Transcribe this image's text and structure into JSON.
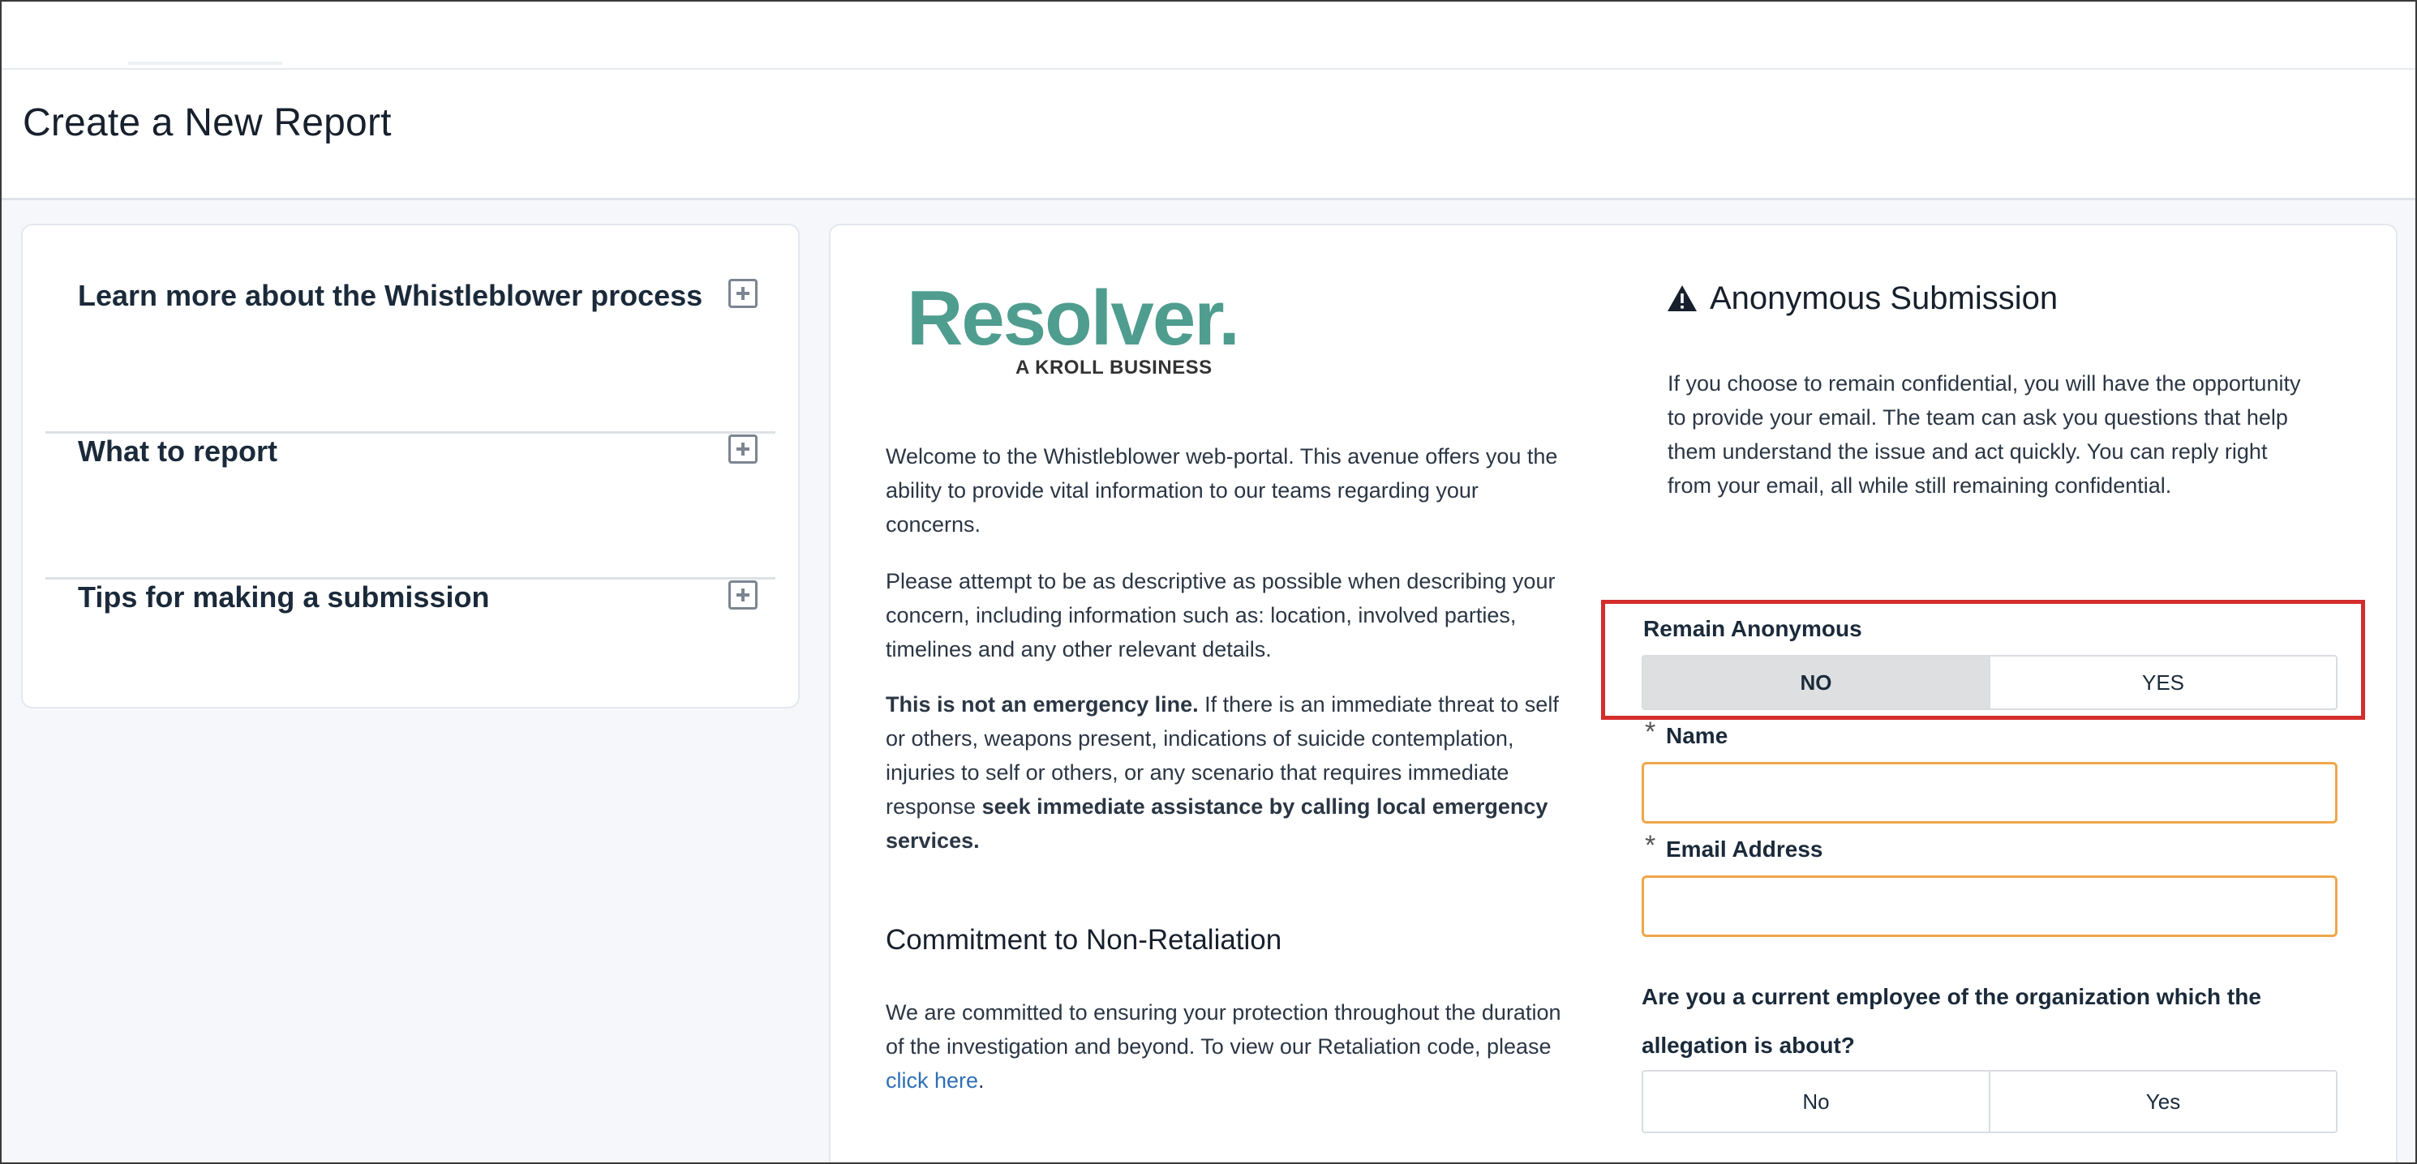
{
  "page": {
    "title": "Create a New Report"
  },
  "sidebar": {
    "items": [
      {
        "label": "Learn more about the Whistleblower process"
      },
      {
        "label": "What to report"
      },
      {
        "label": "Tips for making a submission"
      }
    ]
  },
  "logo": {
    "name": "Resolver.",
    "tagline": "A KROLL BUSINESS"
  },
  "intro": {
    "p1": "Welcome to the Whistleblower web-portal. This avenue offers you the ability to provide vital information to our teams regarding your concerns.",
    "p2": "Please attempt to be as descriptive as possible when describing your concern, including information such as: location, involved parties, timelines and any other relevant details.",
    "p3_bold": "This is not an emergency line.",
    "p3_text": " If there is an immediate threat to self or others, weapons present, indications of suicide contemplation, injuries to self or others, or any scenario that requires immediate response ",
    "p3_bold2": "seek immediate assistance by calling local emergency services."
  },
  "retaliation": {
    "heading": "Commitment to Non-Retaliation",
    "text": "We are committed to ensuring your protection throughout the duration of the investigation and beyond. To view our Retaliation code, please ",
    "link": "click here",
    "end": "."
  },
  "anonymous": {
    "title": "Anonymous Submission",
    "text": "If you choose to remain confidential, you will have the opportunity to provide your email. The team can ask you questions that help them understand the issue and act quickly. You can reply right from your email, all while still remaining confidential."
  },
  "form": {
    "remain_label": "Remain Anonymous",
    "remain_options": [
      "NO",
      "YES"
    ],
    "remain_selected": "NO",
    "required_mark": "*",
    "name_label": "Name",
    "name_value": "",
    "email_label": "Email Address",
    "email_value": "",
    "employee_question": "Are you a current employee of the organization which the allegation is about?",
    "employee_options": [
      "No",
      "Yes"
    ]
  },
  "colors": {
    "brand": "#4f9d8f",
    "highlight": "#d32d2d",
    "field_border": "#f0a64a",
    "link": "#2f6fb5"
  },
  "icons": {
    "accordion": "plus-square-icon",
    "warning": "warning-triangle-icon"
  }
}
